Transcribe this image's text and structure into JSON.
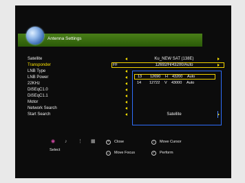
{
  "window": {
    "title": "Antenna Settings"
  },
  "settings": [
    {
      "label": "Satellite",
      "value": "Ku_NEW SAT (138E)"
    },
    {
      "label": "Transponder",
      "value": "12692/H/43200/Auto"
    },
    {
      "label": "LNB Type",
      "value": ""
    },
    {
      "label": "LNB Power",
      "value": ""
    },
    {
      "label": "22KHz",
      "value": ""
    },
    {
      "label": "DiSEqC1.0",
      "value": ""
    },
    {
      "label": "DiSEqC1.1",
      "value": ""
    },
    {
      "label": "Motor",
      "value": ""
    },
    {
      "label": "Network Search",
      "value": ""
    },
    {
      "label": "Start Search",
      "value": "Satellite"
    }
  ],
  "transponder_symbol": "FF",
  "transponder_list": [
    {
      "index": "13",
      "freq": "12690",
      "pol": "H",
      "sym": "43200",
      "mode": "Auto"
    },
    {
      "index": "14",
      "freq": "12722",
      "pol": "V",
      "sym": "43000",
      "mode": "Auto"
    }
  ],
  "footer": {
    "select_label": "Select",
    "close_label": "Close",
    "move_cursor_label": "Move Cursor",
    "move_focus_label": "Move Focus",
    "perform_label": "Perform"
  },
  "colors": {
    "title_bar": "#3c7414",
    "highlight": "#f5d400",
    "list_border": "#2f6fff"
  }
}
